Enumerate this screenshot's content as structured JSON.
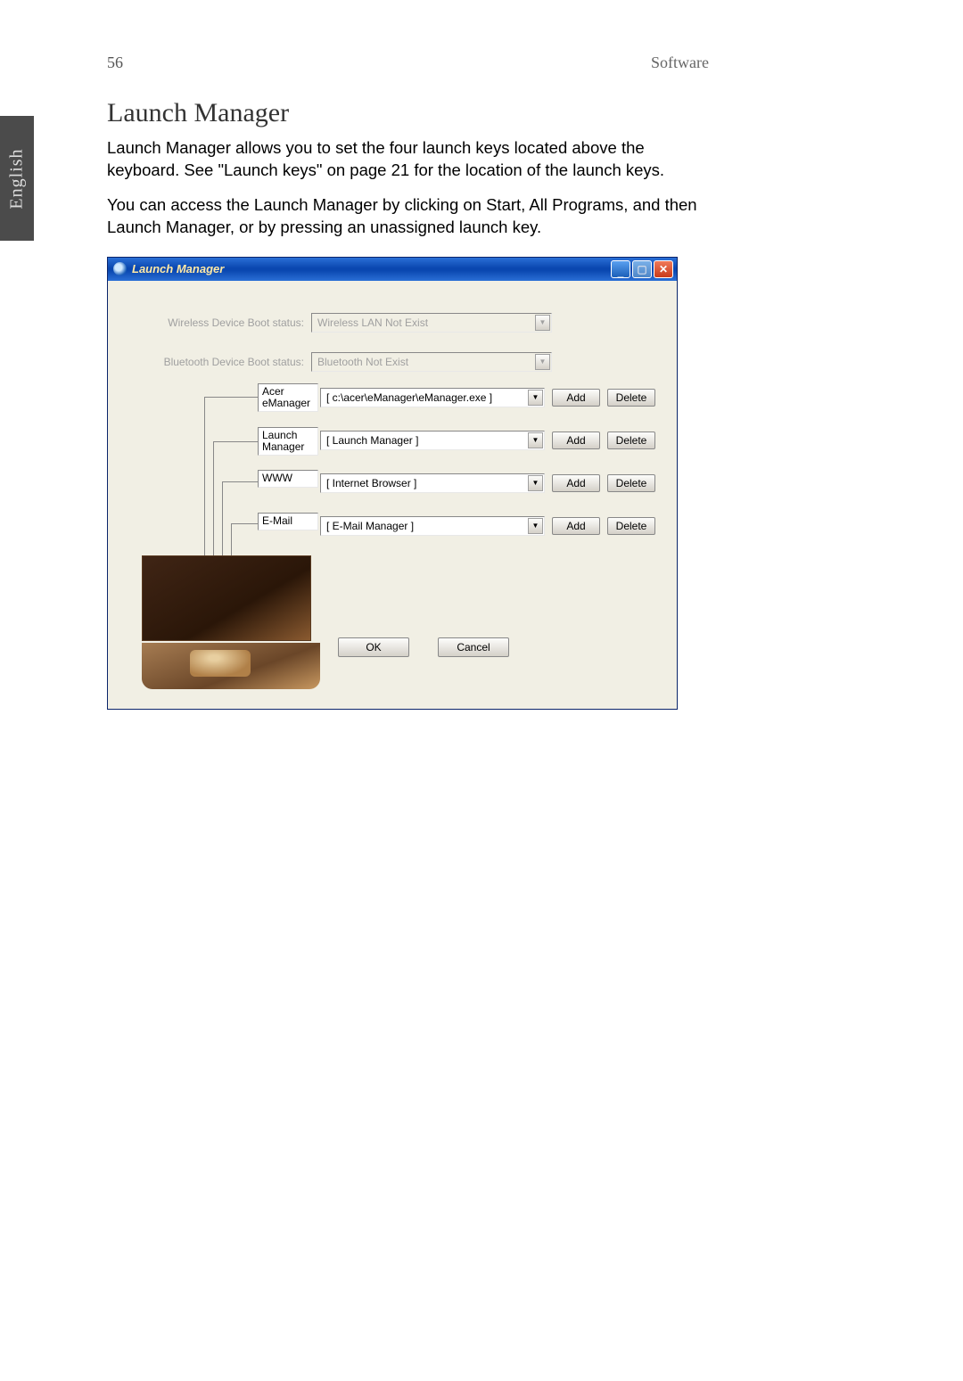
{
  "page": {
    "number": "56",
    "section": "Software",
    "language_tab": "English"
  },
  "heading": "Launch Manager",
  "paragraphs": {
    "p1": "Launch Manager allows you to set the four launch keys located above the keyboard. See \"Launch keys\" on page 21 for the location of the launch keys.",
    "p2": "You can access the Launch Manager by clicking on Start, All Programs, and then Launch Manager, or by pressing an unassigned launch key."
  },
  "window": {
    "title": "Launch Manager",
    "titlebar_buttons": {
      "min": "_",
      "max": "▢",
      "close": "✕"
    },
    "wireless_label": "Wireless Device Boot status:",
    "wireless_value": "Wireless LAN Not Exist",
    "bluetooth_label": "Bluetooth Device Boot status:",
    "bluetooth_value": "Bluetooth Not Exist",
    "add": "Add",
    "delete": "Delete",
    "ok": "OK",
    "cancel": "Cancel",
    "keys": [
      {
        "name": "Acer eManager",
        "value": "[  c:\\acer\\eManager\\eManager.exe  ]"
      },
      {
        "name": "Launch Manager",
        "value": "[  Launch Manager  ]"
      },
      {
        "name": "WWW",
        "value": "[  Internet Browser  ]"
      },
      {
        "name": "E-Mail",
        "value": "[  E-Mail Manager  ]"
      }
    ]
  }
}
